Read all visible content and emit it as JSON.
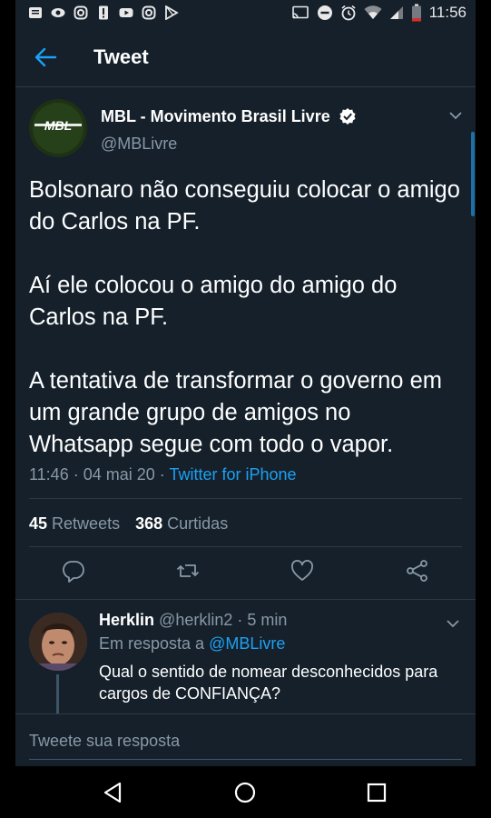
{
  "status_bar": {
    "time": "11:56"
  },
  "header": {
    "title": "Tweet"
  },
  "tweet": {
    "author_name": "MBL - Movimento Brasil Livre",
    "author_handle": "@MBLivre",
    "avatar_text": "MBL",
    "text": "Bolsonaro não conseguiu colocar o amigo do Carlos na PF.\n\nAí ele colocou o amigo do amigo do Carlos na PF.\n\nA tentativa de transformar o governo em um grande grupo de amigos no Whatsapp segue com todo o vapor.",
    "time": "11:46 · 04 mai 20 · ",
    "source": "Twitter for iPhone",
    "retweets_count": "45",
    "retweets_label": "Retweets",
    "likes_count": "368",
    "likes_label": "Curtidas"
  },
  "reply": {
    "author_name": "Herklin",
    "author_handle": "@herklin2",
    "time": " · 5 min",
    "in_reply_label": "Em resposta a ",
    "in_reply_handle": "@MBLivre",
    "text": "Qual o sentido de nomear desconhecidos para\ncargos de CONFIANÇA?"
  },
  "compose": {
    "placeholder": "Tweete sua resposta"
  },
  "colors": {
    "background": "#15202b",
    "accent": "#1da1f2",
    "muted": "#8899a6",
    "divider": "#2b3945"
  },
  "icons": [
    "back-arrow-icon",
    "verified-badge-icon",
    "chevron-down-icon",
    "reply-icon",
    "retweet-icon",
    "like-icon",
    "share-icon",
    "nav-back-icon",
    "nav-home-icon",
    "nav-recents-icon"
  ]
}
